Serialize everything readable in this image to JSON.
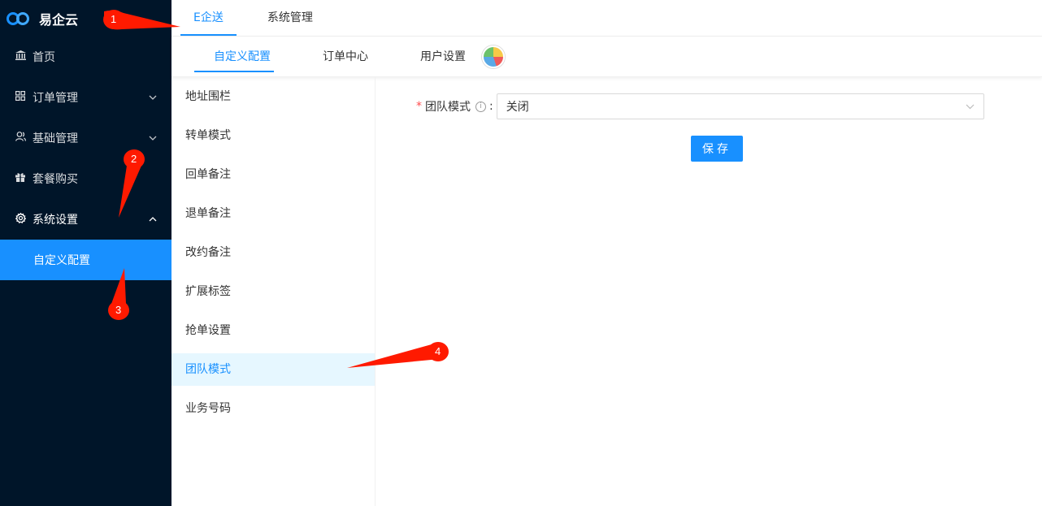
{
  "app": {
    "name": "易企云"
  },
  "sidebar": {
    "items": [
      {
        "label": "首页",
        "icon": "bank-icon"
      },
      {
        "label": "订单管理",
        "icon": "grid-icon",
        "arrow": "down"
      },
      {
        "label": "基础管理",
        "icon": "users-icon",
        "arrow": "down"
      },
      {
        "label": "套餐购买",
        "icon": "gift-icon"
      },
      {
        "label": "系统设置",
        "icon": "gear-icon",
        "arrow": "up"
      }
    ],
    "submenu": {
      "label": "自定义配置"
    }
  },
  "top_tabs": [
    {
      "label": "E企送",
      "active": true
    },
    {
      "label": "系统管理"
    }
  ],
  "sub_tabs": [
    {
      "label": "自定义配置",
      "active": true
    },
    {
      "label": "订单中心"
    },
    {
      "label": "用户设置"
    }
  ],
  "config_list": [
    "地址围栏",
    "转单模式",
    "回单备注",
    "退单备注",
    "改约备注",
    "扩展标签",
    "抢单设置",
    "团队模式",
    "业务号码"
  ],
  "config_active": "团队模式",
  "form": {
    "label": "团队模式",
    "required_mark": "*",
    "colon": ":",
    "select_value": "关闭",
    "save_label": "保存"
  },
  "annotations": [
    "1",
    "2",
    "3",
    "4"
  ],
  "colors": {
    "primary": "#1890ff",
    "sidebar_bg": "#001529",
    "annotation": "#ff1a00"
  }
}
